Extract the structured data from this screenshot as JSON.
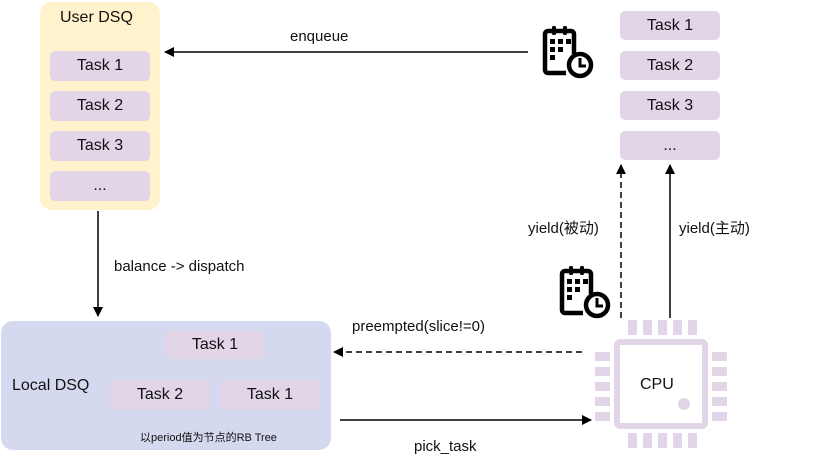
{
  "user_dsq": {
    "title": "User DSQ",
    "items": [
      "Task 1",
      "Task 2",
      "Task 3",
      "..."
    ]
  },
  "right_queue": {
    "items": [
      "Task 1",
      "Task 2",
      "Task 3",
      "..."
    ]
  },
  "local_dsq": {
    "title": "Local DSQ",
    "tree": {
      "root": "Task 1",
      "left": "Task 2",
      "right": "Task 1"
    },
    "note": "以period值为节点的RB Tree"
  },
  "cpu": {
    "label": "CPU"
  },
  "arrows": {
    "enqueue": "enqueue",
    "balance": "balance -> dispatch",
    "preempted": "preempted(slice!=0)",
    "pick_task": "pick_task",
    "yield_passive": "yield(被动)",
    "yield_active": "yield(主动)"
  },
  "colors": {
    "user_dsq_bg": "#fff2cc",
    "task_bg": "#e1d5e7",
    "local_dsq_bg": "#d4d9f0",
    "cpu_stroke": "#e1d5e7",
    "arrow": "#000000"
  },
  "icons": [
    "calendar-clock-icon",
    "cpu-chip-icon"
  ]
}
